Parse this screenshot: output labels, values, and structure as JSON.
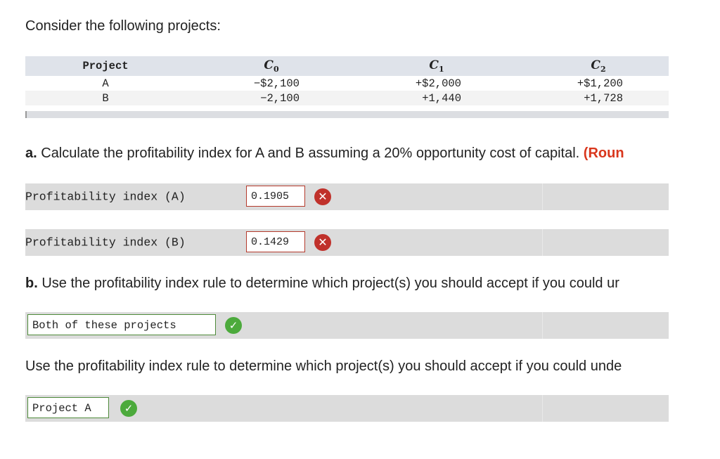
{
  "intro": "Consider the following projects:",
  "table": {
    "headers": {
      "project": "Project",
      "c0": "C",
      "c0_sub": "0",
      "c1": "C",
      "c1_sub": "1",
      "c2": "C",
      "c2_sub": "2"
    },
    "rows": [
      {
        "project": "A",
        "c0": "−$2,100",
        "c1": "+$2,000",
        "c2": "+$1,200"
      },
      {
        "project": "B",
        "c0": "−2,100",
        "c1": "+1,440",
        "c2": "+1,728"
      }
    ]
  },
  "part_a": {
    "label": "a.",
    "text": " Calculate the profitability index for A and B assuming a 20% opportunity cost of capital. ",
    "red_text": "(Roun",
    "rows": [
      {
        "label": "Profitability index (A)",
        "value": "0.1905",
        "status": "incorrect"
      },
      {
        "label": "Profitability index (B)",
        "value": "0.1429",
        "status": "incorrect"
      }
    ]
  },
  "part_b": {
    "label": "b.",
    "text": " Use the profitability index rule to determine which project(s) you should accept if you could ur",
    "answer1": {
      "value": "Both of these projects",
      "status": "correct"
    },
    "text2": "Use the profitability index rule to determine which project(s) you should accept if you could unde",
    "answer2": {
      "value": "Project A",
      "status": "correct"
    }
  },
  "icons": {
    "incorrect": "x-circle-icon",
    "correct": "check-circle-icon"
  },
  "colors": {
    "incorrect": "#c0312b",
    "correct": "#4caa3c",
    "accent_red": "#d9371d"
  }
}
